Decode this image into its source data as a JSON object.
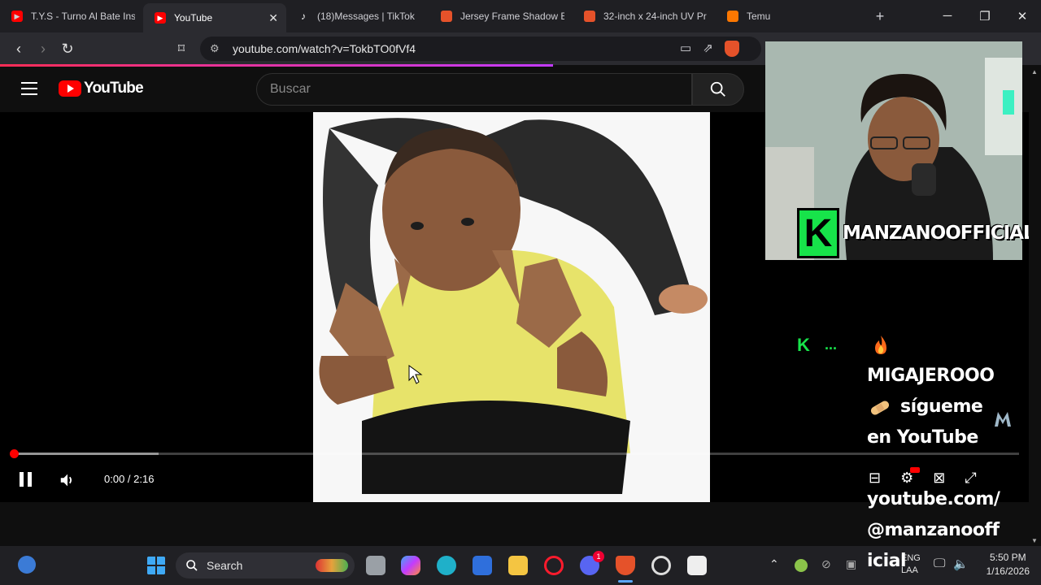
{
  "tabs": [
    {
      "label": "T.Y.S - Turno Al Bate Inst",
      "icon": "youtube-icon",
      "color": "#ff0000"
    },
    {
      "label": "YouTube",
      "icon": "youtube-icon",
      "color": "#ff0000",
      "active": true
    },
    {
      "label": "(18)Messages | TikTok",
      "icon": "tiktok-icon",
      "color": "#ffffff"
    },
    {
      "label": "Jersey Frame Shadow Bo",
      "icon": "shop-icon",
      "color": "#e5522a"
    },
    {
      "label": "32-inch x 24-inch UV Pr",
      "icon": "shop-icon",
      "color": "#e5522a"
    },
    {
      "label": "Temu",
      "icon": "temu-icon",
      "color": "#fb7701"
    }
  ],
  "new_tab": "+",
  "address": {
    "url": "youtube.com/watch?v=TokbTO0fVf4"
  },
  "yt": {
    "logo_text": "YouTube",
    "search_placeholder": "Buscar"
  },
  "player": {
    "time": "0:00 / 2:16",
    "progress_fraction": 0.0,
    "buffered_fraction": 0.144
  },
  "stream": {
    "channel": "MANZANOOFFICIAL",
    "k_label": "K",
    "dots": "...",
    "line1": "MIGAJEROOO",
    "line2": "sígueme",
    "line3": "en YouTube",
    "line4": "youtube.com/",
    "line5": "@manzanooff",
    "line6": "icial"
  },
  "taskbar": {
    "search_label": "Search",
    "lang_top": "ENG",
    "lang_bottom": "LAA",
    "time": "5:50 PM",
    "date": "1/16/2026",
    "discord_badge": "1"
  },
  "colors": {
    "accent": "#ff0000",
    "kick_green": "#17e34a"
  }
}
